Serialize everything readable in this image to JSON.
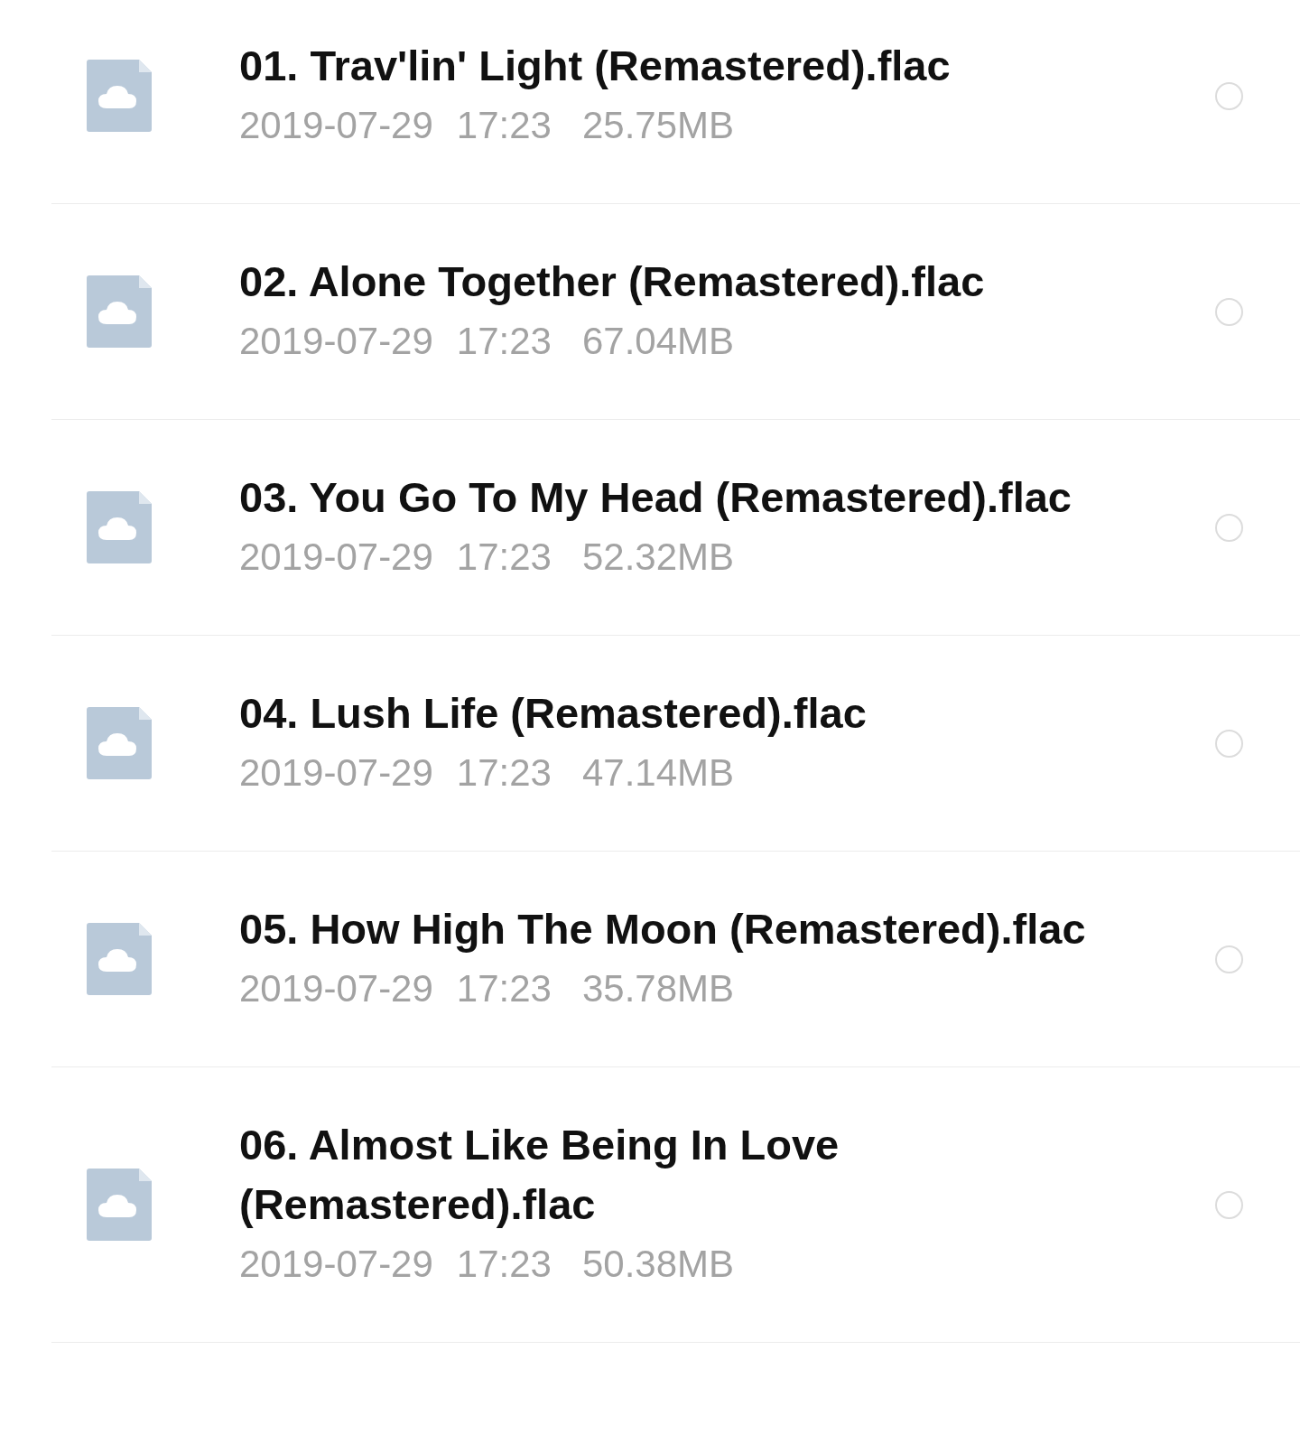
{
  "files": [
    {
      "name": "01. Trav'lin' Light (Remastered).flac",
      "date": "2019-07-29",
      "time": "17:23",
      "size": "25.75MB",
      "selected": false
    },
    {
      "name": "02. Alone Together (Remastered).flac",
      "date": "2019-07-29",
      "time": "17:23",
      "size": "67.04MB",
      "selected": false
    },
    {
      "name": "03. You Go To My Head (Remastered).flac",
      "date": "2019-07-29",
      "time": "17:23",
      "size": "52.32MB",
      "selected": false
    },
    {
      "name": "04. Lush Life (Remastered).flac",
      "date": "2019-07-29",
      "time": "17:23",
      "size": "47.14MB",
      "selected": false
    },
    {
      "name": "05. How High The Moon (Remastered).flac",
      "date": "2019-07-29",
      "time": "17:23",
      "size": "35.78MB",
      "selected": false
    },
    {
      "name": "06. Almost Like Being In Love (Remastered).flac",
      "date": "2019-07-29",
      "time": "17:23",
      "size": "50.38MB",
      "selected": false
    }
  ]
}
